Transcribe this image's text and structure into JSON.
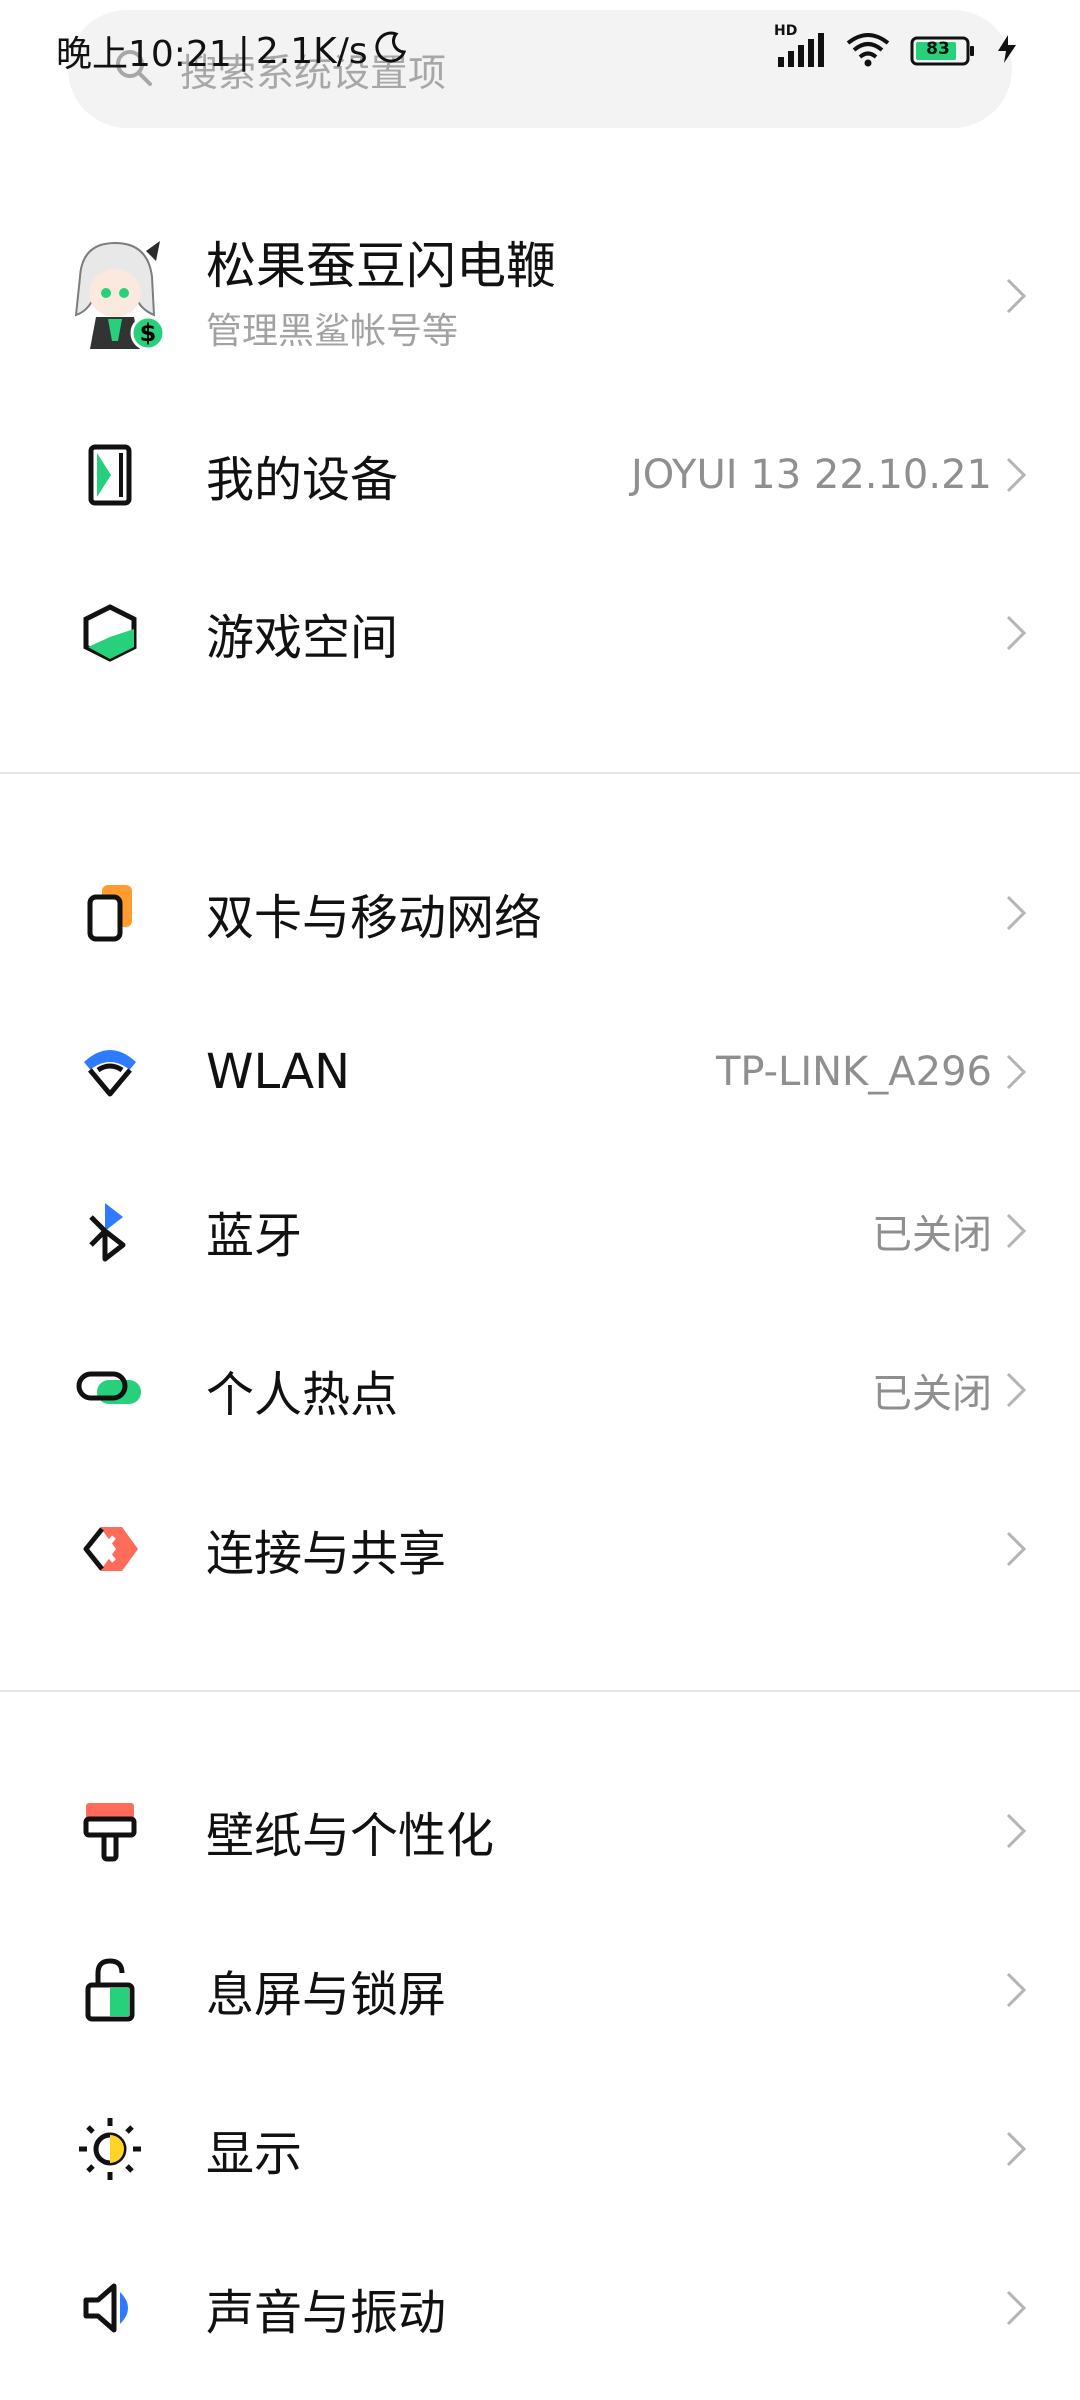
{
  "status": {
    "time": "晚上10:21",
    "speed": "2.1K/s",
    "signal_badge": "HD",
    "battery": "83"
  },
  "search": {
    "placeholder": "搜索系统设置项"
  },
  "account": {
    "name": "松果蚕豆闪电鞭",
    "subtitle": "管理黑鲨帐号等"
  },
  "sections": [
    {
      "items": [
        {
          "label": "我的设备",
          "value": "JOYUI 13 22.10.21",
          "icon": "device-icon"
        },
        {
          "label": "游戏空间",
          "value": "",
          "icon": "game-space-icon"
        }
      ]
    },
    {
      "items": [
        {
          "label": "双卡与移动网络",
          "value": "",
          "icon": "sim-card-icon"
        },
        {
          "label": "WLAN",
          "value": "TP-LINK_A296",
          "icon": "wlan-icon"
        },
        {
          "label": "蓝牙",
          "value": "已关闭",
          "icon": "bluetooth-icon"
        },
        {
          "label": "个人热点",
          "value": "已关闭",
          "icon": "hotspot-icon"
        },
        {
          "label": "连接与共享",
          "value": "",
          "icon": "connection-share-icon"
        }
      ]
    },
    {
      "items": [
        {
          "label": "壁纸与个性化",
          "value": "",
          "icon": "wallpaper-icon"
        },
        {
          "label": "息屏与锁屏",
          "value": "",
          "icon": "lock-screen-icon"
        },
        {
          "label": "显示",
          "value": "",
          "icon": "display-icon"
        },
        {
          "label": "声音与振动",
          "value": "",
          "icon": "sound-icon"
        }
      ]
    }
  ],
  "colors": {
    "accent_green": "#27d07a",
    "accent_blue": "#2f7bff",
    "accent_orange": "#ff9b2f",
    "accent_salmon": "#ff6c5a",
    "accent_yellow": "#ffd428"
  }
}
